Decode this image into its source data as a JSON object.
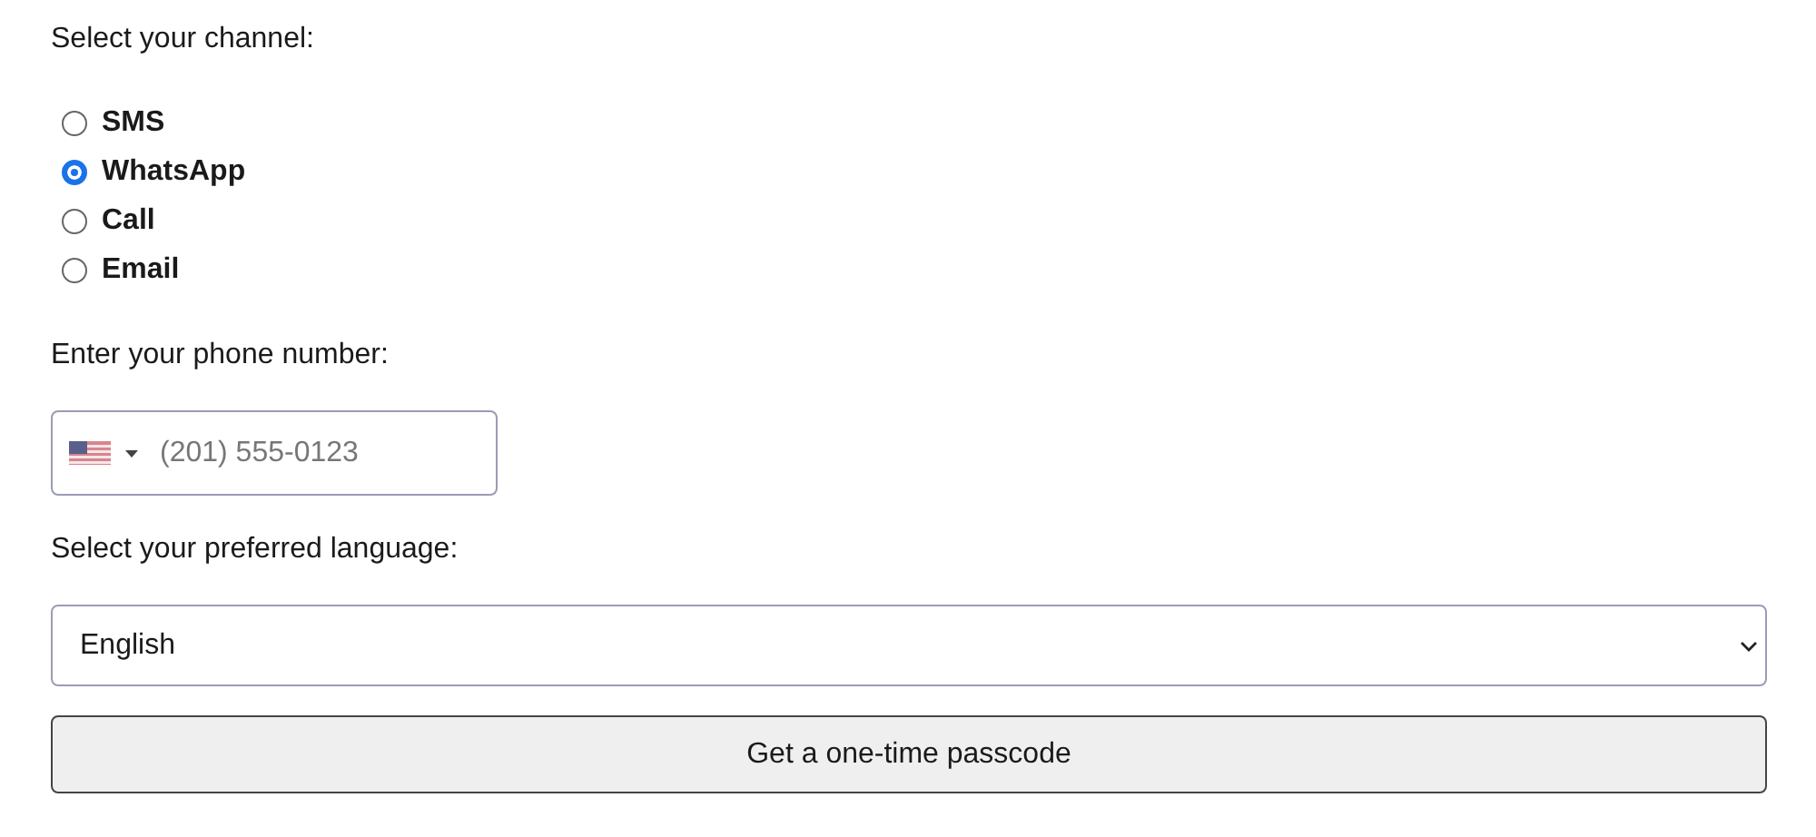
{
  "channel_label": "Select your channel:",
  "channels": [
    {
      "label": "SMS",
      "selected": false
    },
    {
      "label": "WhatsApp",
      "selected": true
    },
    {
      "label": "Call",
      "selected": false
    },
    {
      "label": "Email",
      "selected": false
    }
  ],
  "phone_label": "Enter your phone number:",
  "phone_field": {
    "placeholder": "(201) 555-0123"
  },
  "language_label": "Select your preferred language:",
  "language_select": {
    "value": "English"
  },
  "submit_button": "Get a one-time passcode"
}
